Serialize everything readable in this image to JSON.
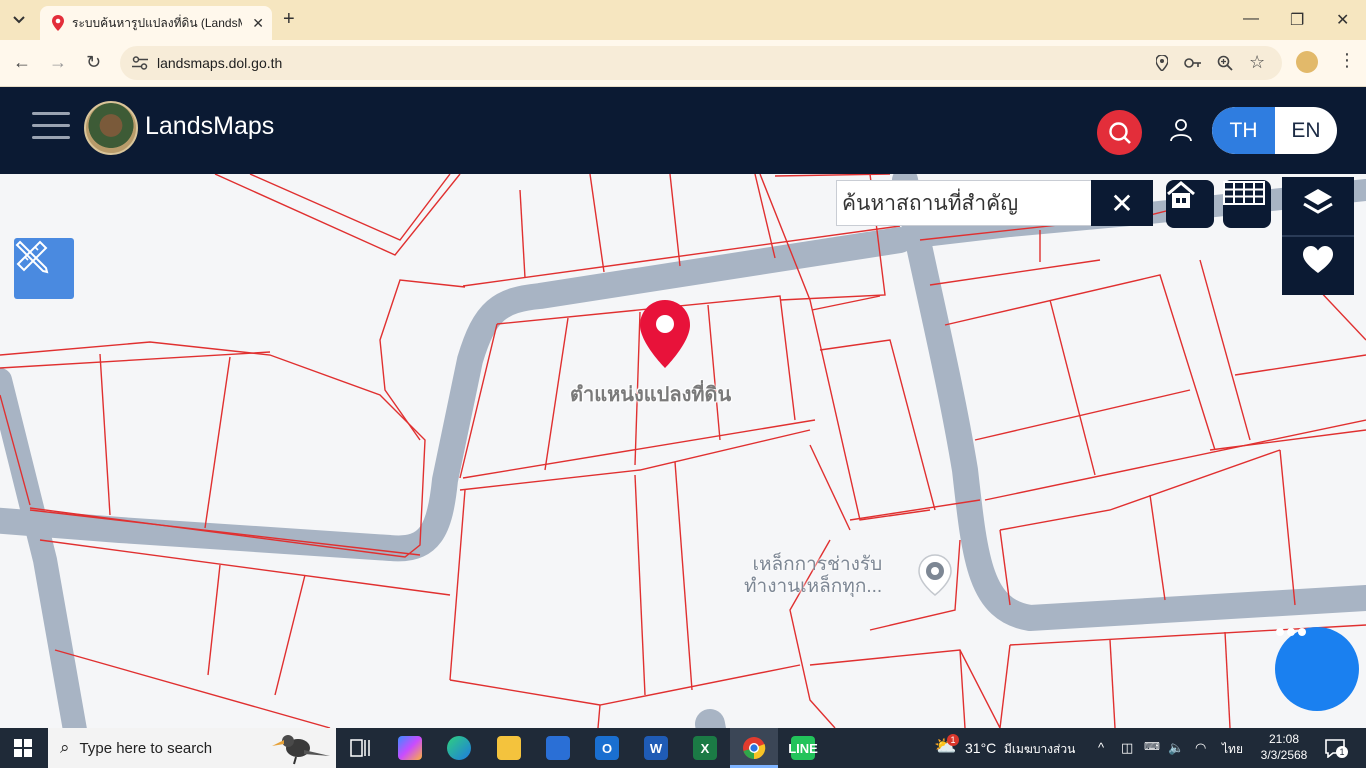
{
  "browser": {
    "tab_title": "ระบบค้นหารูปแปลงที่ดิน (LandsMaps)",
    "new_tab_label": "+",
    "url": "landsmaps.dol.go.th"
  },
  "app": {
    "brand": "LandsMaps",
    "lang_th": "TH",
    "lang_en": "EN"
  },
  "map": {
    "search_placeholder": "ค้นหาสถานที่สำคัญ",
    "parcel_marker_label": "ตำแหน่งแปลงที่ดิน",
    "poi_label_line1": "เหล็กการช่างรับ",
    "poi_label_line2": "ทำงานเหล็กทุก..."
  },
  "taskbar": {
    "search_placeholder": "Type here to search",
    "weather_temp": "31°C",
    "weather_desc": "มีเมฆบางส่วน",
    "weather_badge": "1",
    "language": "ไทย",
    "time": "21:08",
    "date": "3/3/2568",
    "notification_count": "1"
  },
  "colors": {
    "header_bg": "#0b1a33",
    "accent_red": "#e32e3a",
    "accent_blue": "#2f7de0",
    "parcel_line": "#e03030",
    "road": "#a8b4c4"
  }
}
